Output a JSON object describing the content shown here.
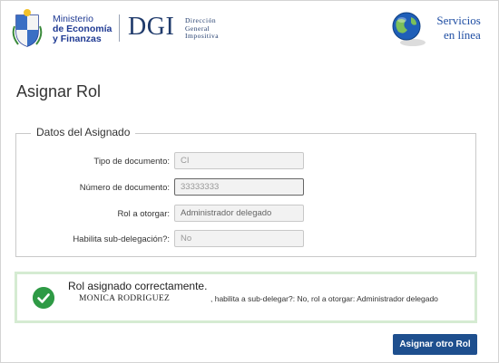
{
  "header": {
    "ministry": {
      "line1": "Ministerio",
      "line2": "de Economía",
      "line3": "y Finanzas"
    },
    "dgi": {
      "logo": "DGI",
      "sub1": "Dirección",
      "sub2": "General",
      "sub3": "Impositiva"
    },
    "services": {
      "line1": "Servicios",
      "line2": "en línea"
    }
  },
  "page": {
    "title": "Asignar Rol"
  },
  "assignee": {
    "legend": "Datos del Asignado",
    "fields": [
      {
        "label": "Tipo de documento:",
        "value": "CI"
      },
      {
        "label": "Número de documento:",
        "value": "33333333"
      },
      {
        "label": "Rol a otorgar:",
        "value": "Administrador delegado"
      },
      {
        "label": "Habilita sub-delegación?:",
        "value": "No"
      }
    ]
  },
  "result": {
    "title": "Rol asignado correctamente.",
    "name": "MONICA RODRIGUEZ",
    "detail": ", habilita a sub-delegar?: No, rol a otorgar: Administrador delegado"
  },
  "actions": {
    "assign_another": "Asignar otro Rol"
  },
  "colors": {
    "brand_blue": "#1e4f8e",
    "success_green": "#2e9a45",
    "success_border": "#d5ebd2"
  }
}
